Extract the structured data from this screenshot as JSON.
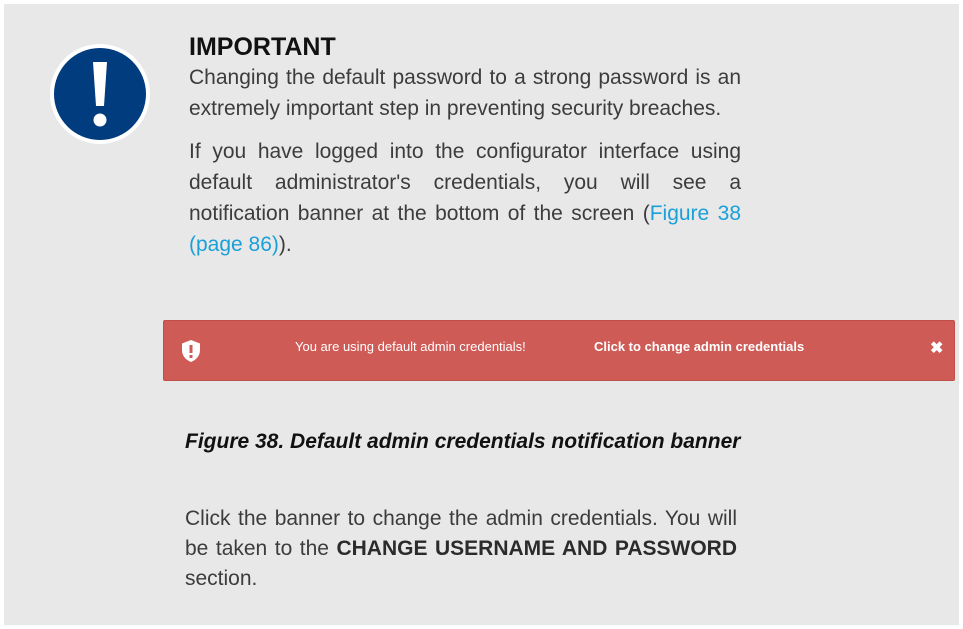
{
  "notice": {
    "heading": "IMPORTANT",
    "para1": "Changing the default password to a strong password is an extremely important step in preventing security breaches.",
    "para2_before": "If you have logged into the configurator interface using default administrator's credentials, you will see a notification banner at the bottom of the screen (",
    "para2_link": "Figure 38 (page 86)",
    "para2_after": ")."
  },
  "banner": {
    "message": "You are using default admin credentials!",
    "link_label": "Click to change admin credentials",
    "close_symbol": "✖",
    "icon": "shield-alert-icon",
    "background": "#cf5b56"
  },
  "figure": {
    "caption": "Figure 38. Default admin credentials notification banner"
  },
  "instructions": {
    "before": "Click the banner to change the admin credentials. You will be taken to the ",
    "section_name": "CHANGE USERNAME AND PASSWORD",
    "after": " section."
  },
  "colors": {
    "panel_background": "#e8e8e8",
    "alert_icon": "#003c7e",
    "link": "#1aa0d8"
  }
}
